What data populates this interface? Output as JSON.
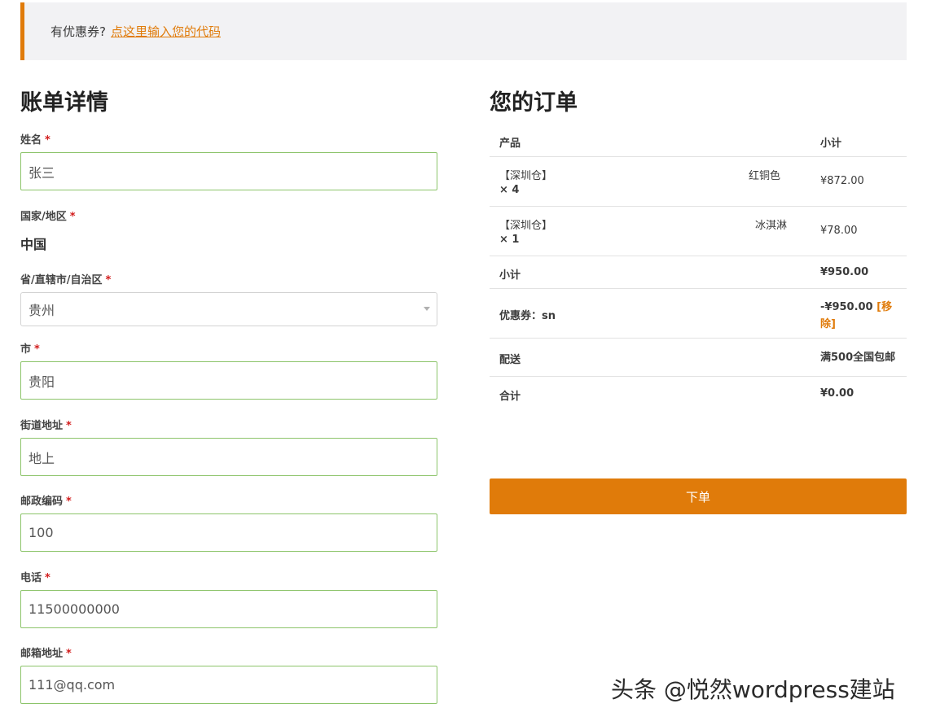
{
  "coupon": {
    "prompt": "有优惠券?",
    "link": "点这里输入您的代码"
  },
  "billing": {
    "title": "账单详情",
    "fields": {
      "name": {
        "label": "姓名",
        "value": "张三"
      },
      "country": {
        "label": "国家/地区",
        "value": "中国"
      },
      "province": {
        "label": "省/直辖市/自治区",
        "value": "贵州"
      },
      "city": {
        "label": "市",
        "value": "贵阳"
      },
      "street": {
        "label": "街道地址",
        "value": "地上"
      },
      "postcode": {
        "label": "邮政编码",
        "value": "100"
      },
      "phone": {
        "label": "电话",
        "value": "11500000000"
      },
      "email": {
        "label": "邮箱地址",
        "value": "111@qq.com"
      }
    },
    "required_mark": "*"
  },
  "order": {
    "title": "您的订单",
    "headers": {
      "product": "产品",
      "subtotal": "小计"
    },
    "items": [
      {
        "name": "【深圳仓】",
        "variant": "红铜色",
        "qty": "× 4",
        "price": "¥872.00"
      },
      {
        "name": "【深圳仓】",
        "variant": "冰淇淋",
        "qty": "× 1",
        "price": "¥78.00"
      }
    ],
    "subtotal": {
      "label": "小计",
      "value": "¥950.00"
    },
    "coupon": {
      "label": "优惠券：sn",
      "value": "-¥950.00",
      "remove": "[移除]"
    },
    "shipping": {
      "label": "配送",
      "value": "满500全国包邮"
    },
    "total": {
      "label": "合计",
      "value": "¥0.00"
    },
    "place_order": "下单"
  },
  "watermark": "头条 @悦然wordpress建站",
  "colors": {
    "accent": "#e07b0a",
    "input_border": "#8cc46a",
    "required": "#d21c1c"
  }
}
